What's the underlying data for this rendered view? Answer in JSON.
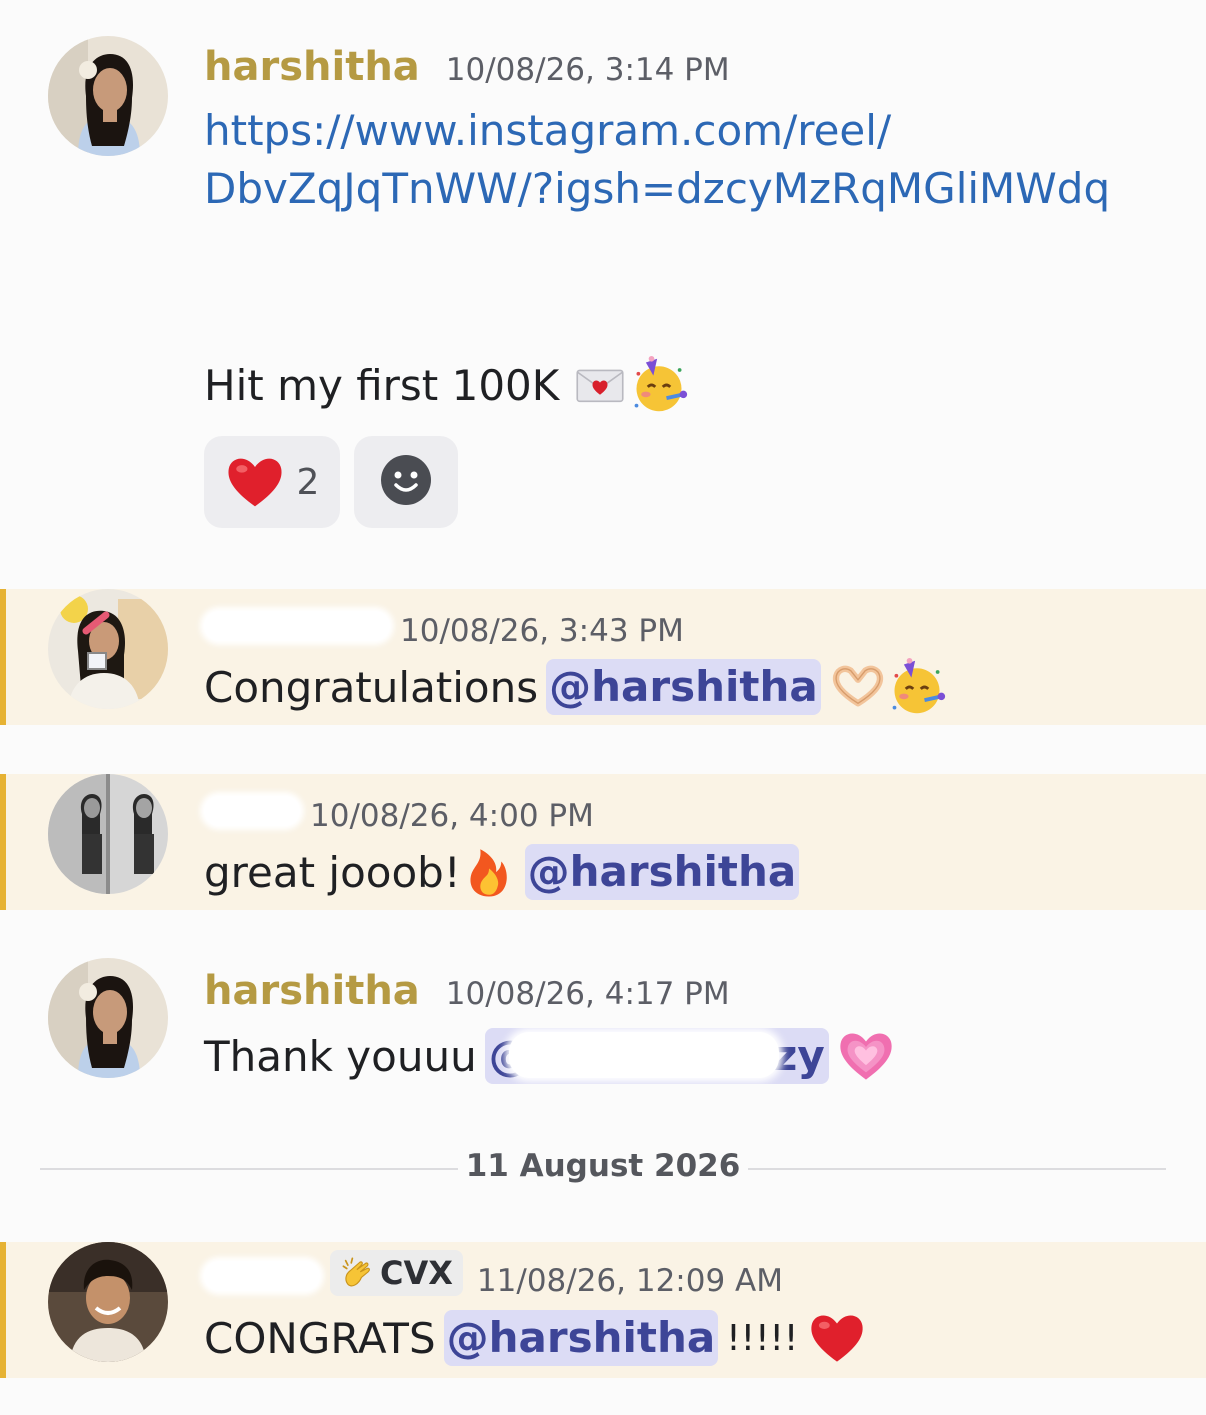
{
  "messages": [
    {
      "username": "harshitha",
      "timestamp": "10/08/26, 3:14 PM",
      "link_line1": "https://www.instagram.com/reel/",
      "link_line2": "DbvZqJqTnWW/?igsh=dzcyMzRqMGliMWdq",
      "text": "Hit my first 100K",
      "emojis": [
        "love-letter-icon",
        "partying-face-icon"
      ],
      "reactions": [
        {
          "emoji": "red-heart-icon",
          "count": "2"
        },
        {
          "emoji": "add-reaction-icon"
        }
      ]
    },
    {
      "username_redacted": true,
      "timestamp": "10/08/26, 3:43 PM",
      "text": "Congratulations",
      "mention": "@harshitha",
      "emojis": [
        "heart-hands-icon",
        "partying-face-icon"
      ],
      "highlighted": true
    },
    {
      "username_redacted": true,
      "timestamp": "10/08/26, 4:00 PM",
      "text": "great jooob!",
      "mention": "@harshitha",
      "emojis": [
        "fire-icon"
      ],
      "highlighted": true
    },
    {
      "username": "harshitha",
      "timestamp": "10/08/26, 4:17 PM",
      "text": "Thank youuu",
      "mention_visible_start": "@",
      "mention_visible_end": "zy",
      "emojis": [
        "growing-heart-icon"
      ]
    },
    {
      "username_redacted": true,
      "badge": {
        "icon": "clapping-hands-icon",
        "label": "CVX"
      },
      "timestamp": "11/08/26, 12:09 AM",
      "text": "CONGRATS",
      "mention": "@harshitha",
      "suffix": "!!!!!",
      "emojis": [
        "red-heart-icon"
      ],
      "highlighted": true
    }
  ],
  "date_divider": "11 August 2026",
  "colors": {
    "username": "#b59a43",
    "link": "#2c68b5",
    "mention_bg": "#dcdcf5",
    "mention_text": "#3d4597",
    "highlight_bg": "#faf3e5",
    "highlight_bar": "#e6b233"
  }
}
